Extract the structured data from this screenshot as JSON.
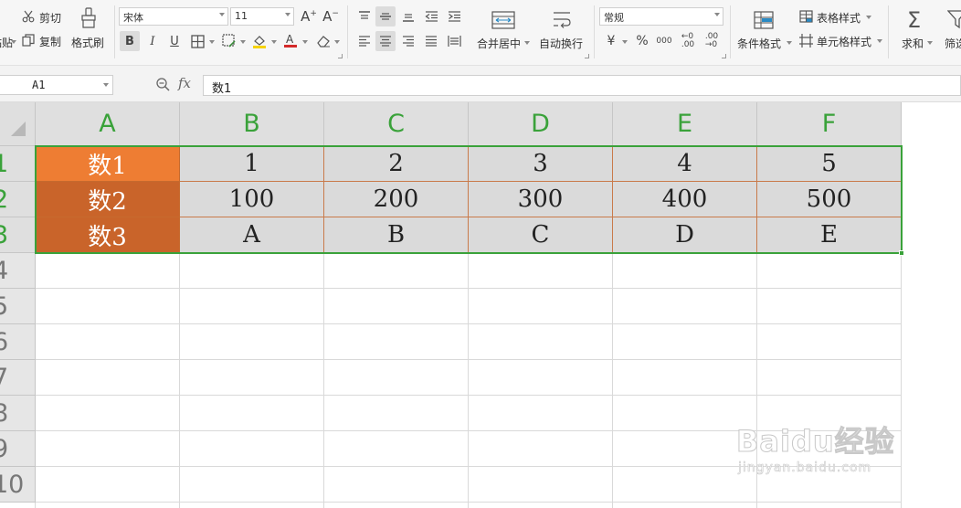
{
  "toolbar": {
    "paste_label": "粘贴",
    "cut_label": "剪切",
    "copy_label": "复制",
    "format_painter_label": "格式刷",
    "font_name": "宋体",
    "font_size": "11",
    "merge_center_label": "合并居中",
    "wrap_text_label": "自动换行",
    "number_format": "常规",
    "conditional_format_label": "条件格式",
    "table_style_label": "表格样式",
    "cell_style_label": "单元格样式",
    "sum_label": "求和",
    "filter_label": "筛选"
  },
  "formula_bar": {
    "name_box": "A1",
    "fx_label": "fx",
    "content": "数1"
  },
  "sheet": {
    "columns": [
      "A",
      "B",
      "C",
      "D",
      "E",
      "F"
    ],
    "rows": [
      "1",
      "2",
      "3",
      "4",
      "5",
      "6",
      "7",
      "8",
      "9",
      "10"
    ],
    "data": [
      [
        "数1",
        "1",
        "2",
        "3",
        "4",
        "5"
      ],
      [
        "数2",
        "100",
        "200",
        "300",
        "400",
        "500"
      ],
      [
        "数3",
        "A",
        "B",
        "C",
        "D",
        "E"
      ]
    ]
  },
  "colors": {
    "selection": "#3aa23a",
    "header_cell_row1": "#ee7d33",
    "header_cell_rows23": "#c9642a",
    "data_fill": "#dadada"
  },
  "watermark": {
    "brand": "Baidu经验",
    "url": "jingyan.baidu.com"
  }
}
